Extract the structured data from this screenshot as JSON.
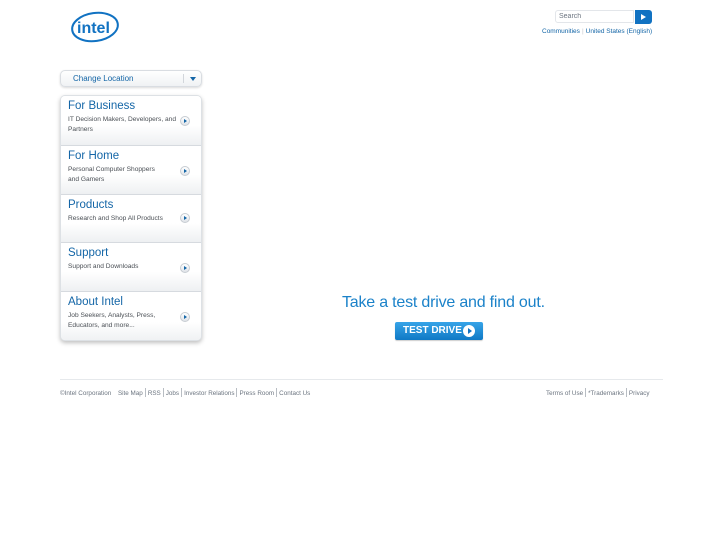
{
  "header": {
    "logo_text": "intel",
    "search": {
      "placeholder": "Search"
    },
    "links": [
      "Communities",
      "United States (English)"
    ]
  },
  "location": {
    "label": "Change Location"
  },
  "nav": [
    {
      "title": "For Business",
      "desc": "IT Decision Makers, Developers, and Partners"
    },
    {
      "title": "For Home",
      "desc": "Personal Computer Shoppers and Gamers"
    },
    {
      "title": "Products",
      "desc": "Research and Shop All Products"
    },
    {
      "title": "Support",
      "desc": "Support and Downloads"
    },
    {
      "title": "About Intel",
      "desc": "Job Seekers, Analysts, Press, Educators, and more..."
    }
  ],
  "promo": {
    "tagline": "Take a test drive and find out.",
    "button_label": "TEST DRIVE"
  },
  "footer": {
    "copyright": "©Intel Corporation",
    "left_links": [
      "Site Map",
      "RSS",
      "Jobs",
      "Investor Relations",
      "Press Room",
      "Contact Us"
    ],
    "right_links": [
      "Terms of Use",
      "*Trademarks",
      "Privacy"
    ]
  },
  "colors": {
    "brand_blue": "#1172c2",
    "link_blue": "#1466a7",
    "promo_blue": "#1b82c9"
  }
}
